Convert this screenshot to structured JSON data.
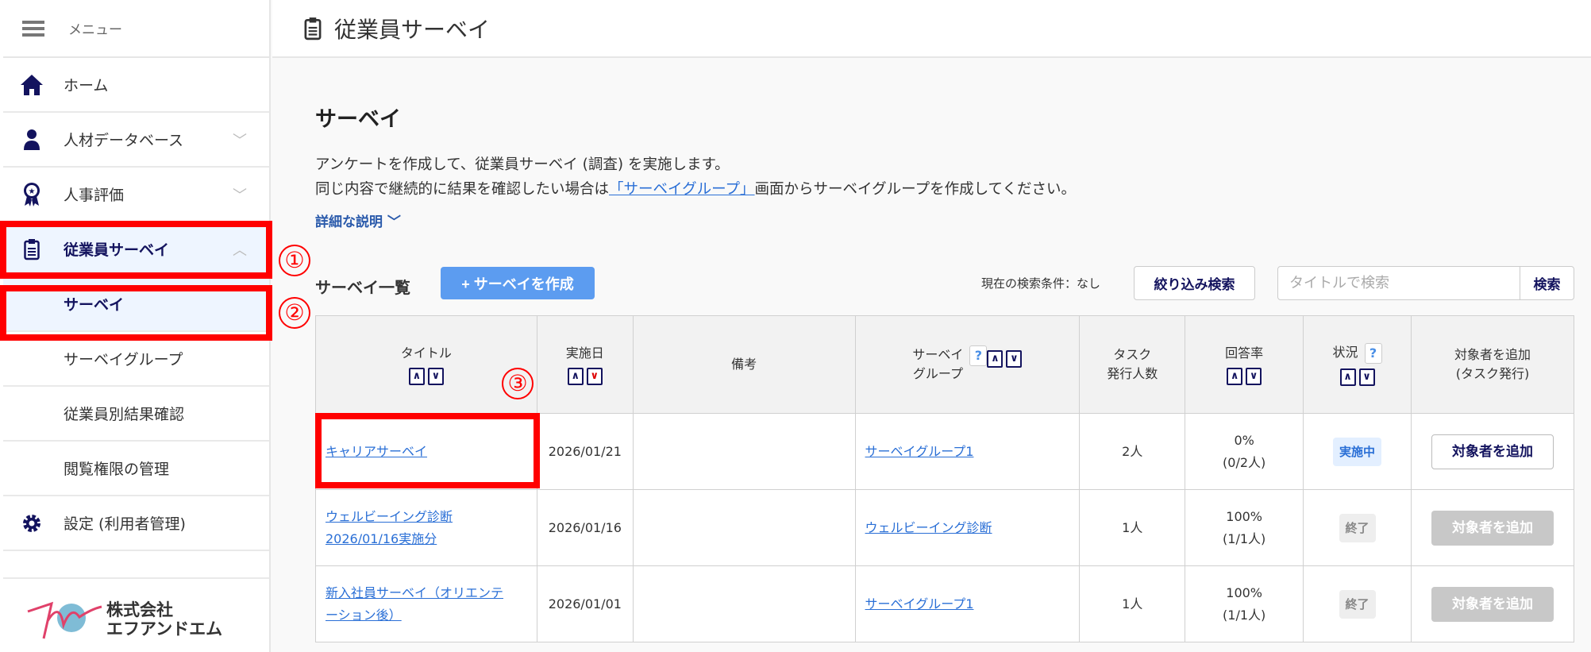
{
  "sidebar": {
    "menu_label": "メニュー",
    "items": [
      {
        "label": "ホーム",
        "icon": "home-icon"
      },
      {
        "label": "人材データベース",
        "icon": "person-icon"
      },
      {
        "label": "人事評価",
        "icon": "award-icon"
      },
      {
        "label": "従業員サーベイ",
        "icon": "clipboard-icon"
      },
      {
        "label": "サーベイ"
      },
      {
        "label": "サーベイグループ"
      },
      {
        "label": "従業員別結果確認"
      },
      {
        "label": "閲覧権限の管理"
      },
      {
        "label": "設定 (利用者管理)",
        "icon": "gear-icon"
      }
    ],
    "logo": {
      "line1": "株式会社",
      "line2": "エフアンドエム"
    }
  },
  "header": {
    "title": "従業員サーベイ"
  },
  "main": {
    "title": "サーベイ",
    "desc1": "アンケートを作成して、従業員サーベイ (調査) を実施します。",
    "desc2_pre": "同じ内容で継続的に結果を確認したい場合は",
    "desc2_link": "「サーベイグループ」",
    "desc2_post": "画面からサーベイグループを作成してください。",
    "more": "詳細な説明",
    "list_title": "サーベイ一覧",
    "create_label": "+ サーベイを作成",
    "condition": "現在の検索条件：なし",
    "filter_label": "絞り込み検索",
    "search_placeholder": "タイトルで検索",
    "search_label": "検索"
  },
  "table": {
    "headers": [
      "タイトル",
      "実施日",
      "備考",
      "サーベイ",
      "グループ",
      "タスク",
      "発行人数",
      "回答率",
      "状況",
      "対象者を追加",
      "(タスク発行)"
    ],
    "rows": [
      {
        "title1": "キャリアサーベイ",
        "title2": "",
        "date": "2026/01/21",
        "note": "",
        "group": "サーベイグループ1",
        "count": "2人",
        "rate": "0%",
        "rate_detail": "(0/2人)",
        "status": "実施中",
        "status_type": "running",
        "action": "対象者を追加",
        "action_enabled": true
      },
      {
        "title1": "ウェルビーイング診断",
        "title2": "2026/01/16実施分",
        "date": "2026/01/16",
        "note": "",
        "group": "ウェルビーイング診断",
        "count": "1人",
        "rate": "100%",
        "rate_detail": "(1/1人)",
        "status": "終了",
        "status_type": "ended",
        "action": "対象者を追加",
        "action_enabled": false
      },
      {
        "title1": "新入社員サーベイ（オリエンテ",
        "title2": "ーション後）",
        "date": "2026/01/01",
        "note": "",
        "group": "サーベイグループ1",
        "count": "1人",
        "rate": "100%",
        "rate_detail": "(1/1人)",
        "status": "終了",
        "status_type": "ended",
        "action": "対象者を追加",
        "action_enabled": false
      }
    ]
  },
  "annotations": [
    "①",
    "②",
    "③"
  ],
  "colors": {
    "accent": "#5c9cf0",
    "navy": "#13135e",
    "annotation": "#ff0000",
    "link": "#2a6fd6"
  }
}
